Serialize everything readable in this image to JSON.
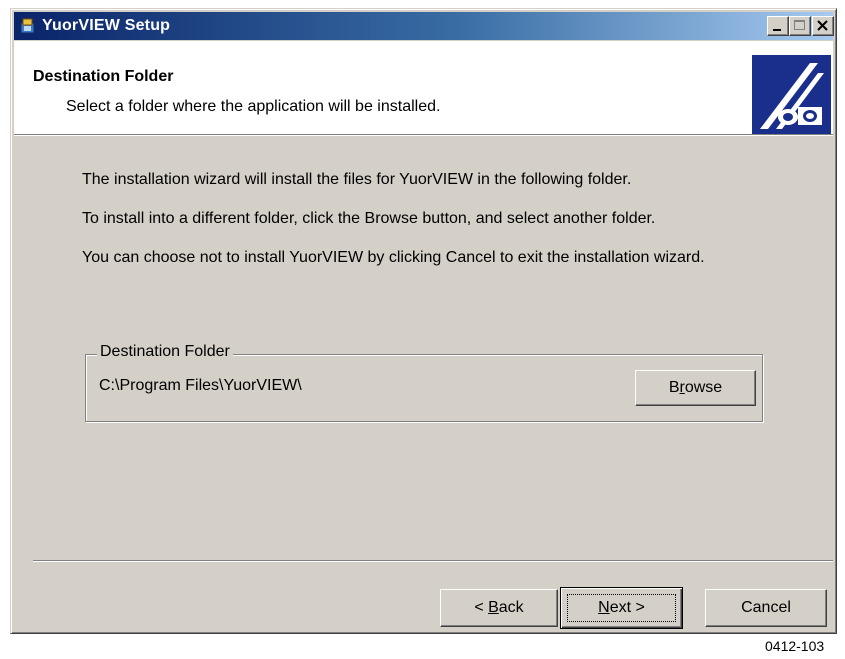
{
  "window": {
    "title": "YuorVIEW Setup"
  },
  "header": {
    "title": "Destination Folder",
    "subtitle": "Select a folder where the application will be installed."
  },
  "body": {
    "line1": "The installation wizard will install the files for YuorVIEW in the following folder.",
    "line2": "To install into a different folder, click the Browse button, and select another folder.",
    "line3": "You can choose not to install YuorVIEW by clicking Cancel to exit the installation wizard."
  },
  "destination": {
    "group_label": "Destination Folder",
    "path": "C:\\Program Files\\YuorVIEW\\",
    "browse_pre": "B",
    "browse_mnemonic": "r",
    "browse_post": "owse"
  },
  "buttons": {
    "back_pre": "< ",
    "back_mnemonic": "B",
    "back_post": "ack",
    "next_mnemonic": "N",
    "next_post": "ext >",
    "cancel": "Cancel"
  },
  "caption": "0412-103",
  "colors": {
    "title_start": "#0a246a",
    "title_end": "#a6caf0",
    "face": "#d4d0c8"
  }
}
